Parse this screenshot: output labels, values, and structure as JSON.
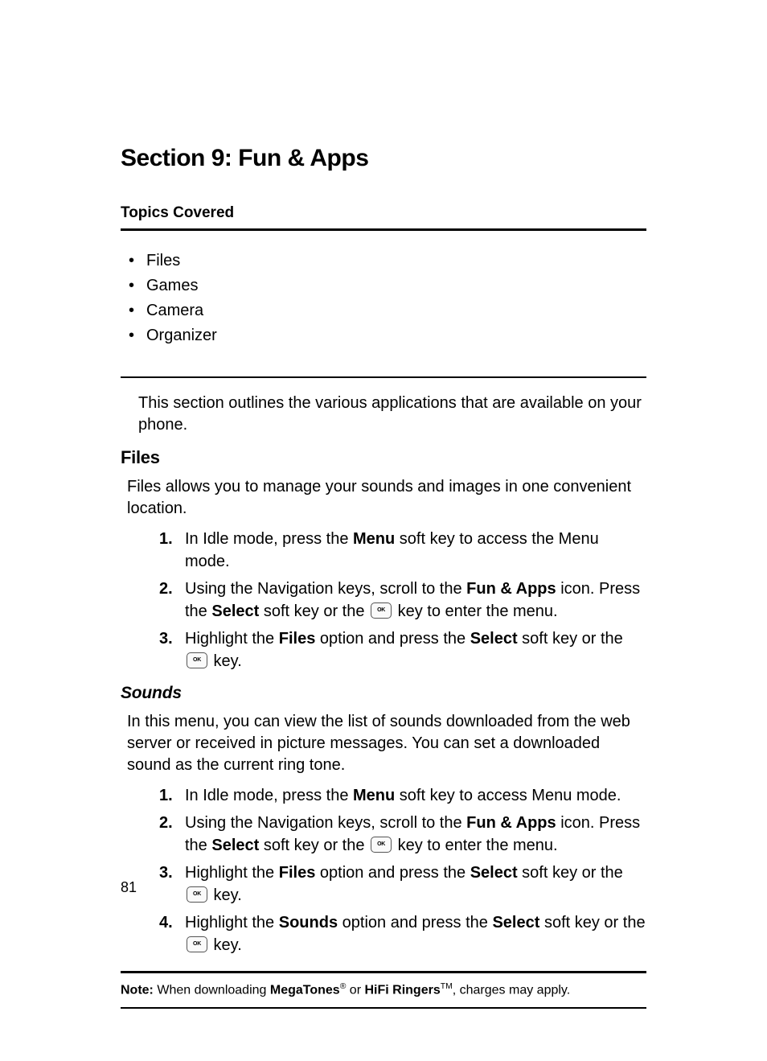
{
  "section_title": "Section 9: Fun & Apps",
  "topics": {
    "heading": "Topics Covered",
    "items": [
      "Files",
      "Games",
      "Camera",
      "Organizer"
    ]
  },
  "intro": "This section outlines the various applications that are available on your phone.",
  "files": {
    "heading": "Files",
    "intro": "Files allows you to manage your sounds and images in one convenient location.",
    "steps": {
      "s1": {
        "num": "1.",
        "pre": "In Idle mode, press the ",
        "b1": "Menu",
        "post": " soft key to access the Menu mode."
      },
      "s2": {
        "num": "2.",
        "pre": "Using the Navigation keys, scroll to the ",
        "b1": "Fun & Apps",
        "mid": " icon. Press the ",
        "b2": "Select",
        "post1": " soft key or the ",
        "post2": " key to enter the menu."
      },
      "s3": {
        "num": "3.",
        "pre": "Highlight the ",
        "b1": "Files",
        "mid": " option and press the ",
        "b2": "Select",
        "post1": " soft key or the ",
        "post2": " key."
      }
    }
  },
  "sounds": {
    "heading": "Sounds",
    "intro": "In this menu, you can view the list of sounds downloaded from the web server or received in picture messages. You can set a downloaded sound as the current ring tone.",
    "steps": {
      "s1": {
        "num": "1.",
        "pre": "In Idle mode, press the ",
        "b1": "Menu",
        "post": " soft key to access Menu mode."
      },
      "s2": {
        "num": "2.",
        "pre": "Using the Navigation keys, scroll to the ",
        "b1": "Fun & Apps",
        "mid": " icon. Press the ",
        "b2": "Select",
        "post1": " soft key or the ",
        "post2": " key to enter the menu."
      },
      "s3": {
        "num": "3.",
        "pre": "Highlight the ",
        "b1": "Files",
        "mid": " option and press the ",
        "b2": "Select",
        "post1": " soft key or the ",
        "post2": " key."
      },
      "s4": {
        "num": "4.",
        "pre": "Highlight the ",
        "b1": "Sounds",
        "mid": " option and press the ",
        "b2": "Select",
        "post1": " soft key or the ",
        "post2": " key."
      }
    }
  },
  "note": {
    "label": "Note:",
    "pre": " When downloading ",
    "b1": "MegaTones",
    "sup1": "®",
    "mid": " or ",
    "b2": "HiFi Ringers",
    "sup2": "TM",
    "post": ", charges may apply."
  },
  "page_number": "81"
}
